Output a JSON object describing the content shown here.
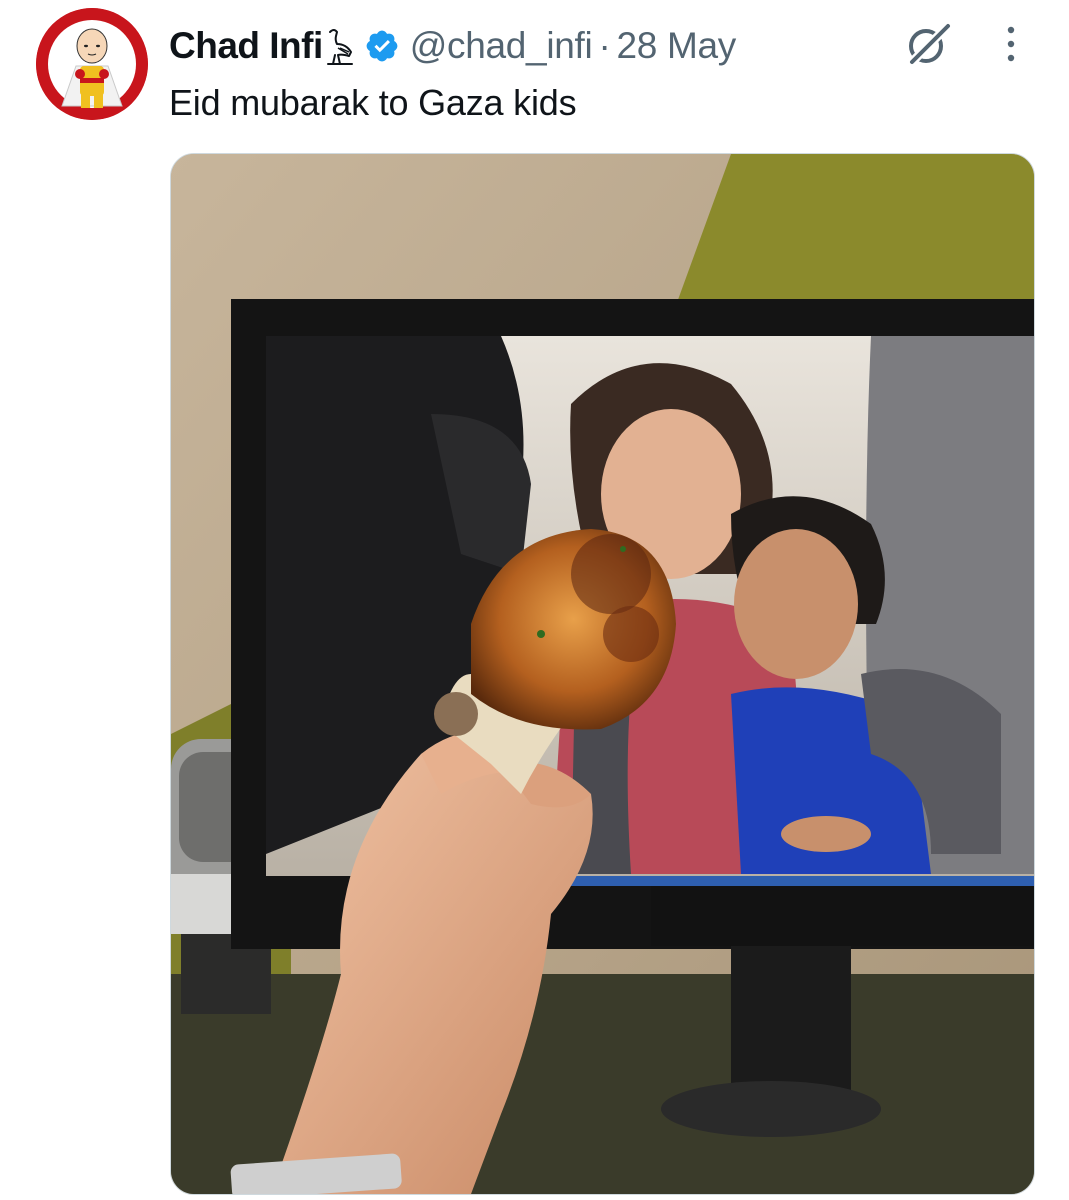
{
  "tweet": {
    "display_name": "Chad Infi",
    "handle": "@chad_infi",
    "separator": "·",
    "timestamp": "28 May",
    "text": "Eid mubarak to Gaza kids",
    "verified": true
  },
  "icons": {
    "avatar": "avatar-cartoon-bald-hero",
    "name_emoji": "ostrich-hieroglyph-emoji",
    "verified": "verified-badge-icon",
    "grok": "grok-icon",
    "more": "more-options-icon"
  },
  "colors": {
    "verified_blue": "#1d9bf0",
    "secondary_text": "#536471",
    "primary_text": "#0f1419",
    "avatar_background": "#c8151c"
  }
}
